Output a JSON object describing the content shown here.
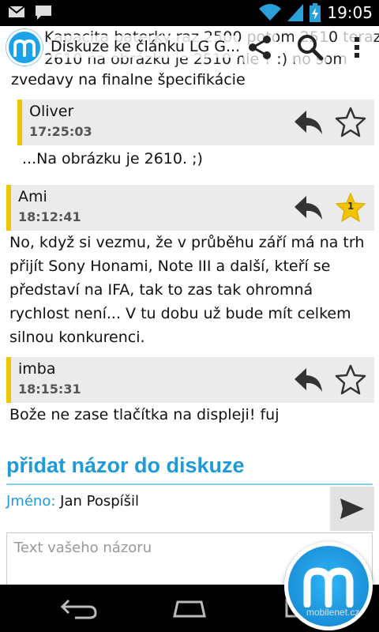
{
  "status_bar": {
    "time": "19:05",
    "icons": [
      "gmail-icon",
      "chat-icon",
      "wifi-icon",
      "signal-icon",
      "battery-charging-icon"
    ]
  },
  "action_bar": {
    "title": "Diskuze ke článku LG G...",
    "ghost_line1": "Kapacita baterky raz 2500 potom 2510 teraz",
    "ghost_line2": "2610 na obrázku je 2510 nie ? :) no som"
  },
  "intro_text": "zvedavy na finalne špecifikácie",
  "comments": [
    {
      "author": "Oliver",
      "time": "17:25:03",
      "text": "...Na obrázku je 2610. ;)",
      "likes": ""
    },
    {
      "author": "Ami",
      "time": "18:12:41",
      "text": "No, když si vezmu, že v průběhu září má na trh přijít Sony Honami, Note III a další, kteří se představí na IFA, tak to zas tak ohromná rychlost není... V tu dobu už bude mít celkem silnou konkurenci.",
      "likes": "1"
    },
    {
      "author": "imba",
      "time": "18:15:31",
      "text": "Bože ne zase tlačítka na displeji! fuj",
      "likes": ""
    }
  ],
  "form": {
    "section_title": "přidat názor do diskuze",
    "name_label": "Jméno:",
    "name_value": "Jan Pospíšil",
    "textarea_placeholder": "Text vašeho názoru"
  },
  "watermark": "mobilenet.cz",
  "colors": {
    "accent": "#1e9ad8",
    "comment_bar": "#f2c400",
    "star_active": "#f2c400"
  }
}
